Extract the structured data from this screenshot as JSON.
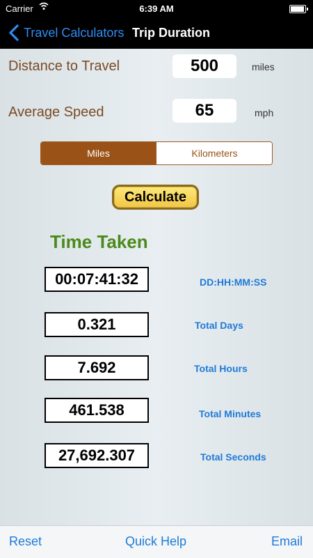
{
  "status_bar": {
    "carrier": "Carrier",
    "wifi_icon": "wifi-icon",
    "time": "6:39 AM",
    "battery_level": 0.95
  },
  "nav": {
    "back_label": "Travel Calculators",
    "title": "Trip Duration",
    "back_color": "#2f8ef5"
  },
  "inputs": {
    "distance": {
      "label": "Distance to Travel",
      "value": "500",
      "unit": "miles"
    },
    "speed": {
      "label": "Average Speed",
      "value": "65",
      "unit": "mph"
    }
  },
  "units_toggle": {
    "options": [
      "Miles",
      "Kilometers"
    ],
    "selected": "Miles",
    "accent": "#9a5216"
  },
  "calculate_label": "Calculate",
  "results": {
    "heading": "Time Taken",
    "items": [
      {
        "value": "00:07:41:32",
        "label": "DD:HH:MM:SS"
      },
      {
        "value": "0.321",
        "label": "Total Days"
      },
      {
        "value": "7.692",
        "label": "Total Hours"
      },
      {
        "value": "461.538",
        "label": "Total Minutes"
      },
      {
        "value": "27,692.307",
        "label": "Total Seconds"
      }
    ]
  },
  "toolbar": {
    "reset": "Reset",
    "quick_help": "Quick Help",
    "email": "Email"
  }
}
